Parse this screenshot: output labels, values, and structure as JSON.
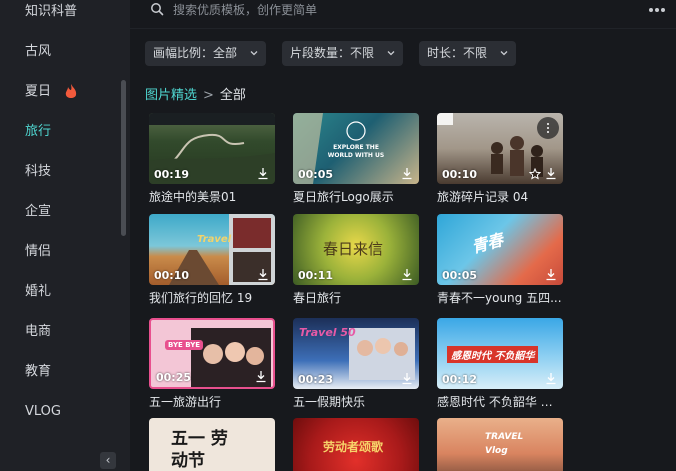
{
  "sidebar": {
    "items": [
      {
        "label": "知识科普",
        "active": false
      },
      {
        "label": "古风",
        "active": false
      },
      {
        "label": "夏日",
        "active": false
      },
      {
        "label": "旅行",
        "active": true
      },
      {
        "label": "科技",
        "active": false
      },
      {
        "label": "企宣",
        "active": false
      },
      {
        "label": "情侣",
        "active": false
      },
      {
        "label": "婚礼",
        "active": false
      },
      {
        "label": "电商",
        "active": false
      },
      {
        "label": "教育",
        "active": false
      },
      {
        "label": "VLOG",
        "active": false
      }
    ],
    "collapse_glyph": "‹"
  },
  "search": {
    "placeholder": "搜索优质模板，创作更简单"
  },
  "filters": [
    {
      "label": "画幅比例：全部"
    },
    {
      "label": "片段数量：不限"
    },
    {
      "label": "时长：不限"
    }
  ],
  "breadcrumb": {
    "parent": "图片精选",
    "separator": ">",
    "current": "全部"
  },
  "templates": [
    {
      "title": "旅途中的美景01",
      "duration": "00:19"
    },
    {
      "title": "夏日旅行Logo展示",
      "duration": "00:05",
      "overlay": "EXPLORE THE WORLD WITH US"
    },
    {
      "title": "旅游碎片记录 04",
      "duration": "00:10"
    },
    {
      "title": "我们旅行的回忆 19",
      "duration": "00:10",
      "overlay": "Travel"
    },
    {
      "title": "春日旅行",
      "duration": "00:11",
      "overlay": "春日来信"
    },
    {
      "title": "青春不一young 五四...",
      "duration": "00:05",
      "overlay": "青春"
    },
    {
      "title": "五一旅游出行",
      "duration": "00:25",
      "overlay": "BYE BYE"
    },
    {
      "title": "五一假期快乐",
      "duration": "00:23",
      "overlay": "Travel 50"
    },
    {
      "title": "感恩时代 不负韶华 五...",
      "duration": "00:12",
      "overlay": "感恩时代  不负韶华"
    },
    {
      "title": "",
      "duration": "",
      "overlay": "五一 劳动节"
    },
    {
      "title": "",
      "duration": "",
      "overlay": "劳动者颂歌"
    },
    {
      "title": "",
      "duration": "",
      "overlay": "TRAVEL Vlog"
    }
  ],
  "colors": {
    "accent": "#4fd6d0",
    "background": "#17191d",
    "sidebar": "#1f2126"
  }
}
